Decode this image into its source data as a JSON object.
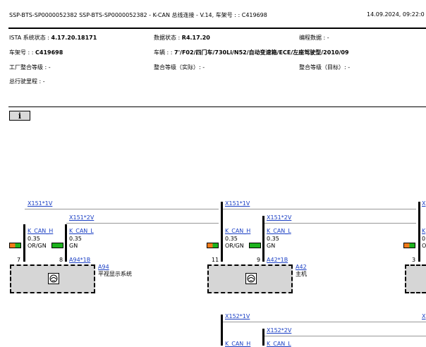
{
  "header": {
    "title": "SSP-BTS-SP0000052382  SSP-BTS-SP0000052382  - K-CAN 总线连接 - V.14, 车架号 : : C419698",
    "datetime": "14.09.2024,  09:22:0"
  },
  "info": {
    "ista_label": "ISTA 系统状态 : ",
    "ista_value": "4.17.20.18171",
    "data_label": "数据状态 : ",
    "data_value": "R4.17.20",
    "prog_label": "编程数据 : -",
    "vin_label": "车架号 : : ",
    "vin_value": "C419698",
    "vehicle_label": "车辆 : : ",
    "vehicle_value": "7'/F02/四门车/730Li/N52/自动变速箱/ECE/左座驾驶型/2010/09",
    "factory_level": "工厂整合等级 : -",
    "actual_level": "整合等级（实际）: -",
    "target_level": "整合等级（目标）: -",
    "mileage": "总行驶里程 : -"
  },
  "info_button": {
    "label": "i"
  },
  "diagram": {
    "modules": [
      {
        "conn1": "X151*1V",
        "conn2": "X151*2V",
        "pin_a": "7",
        "pin_b": "8",
        "w1_name": "K_CAN_H",
        "w1_size": "0.35",
        "w1_color": "OR/GN",
        "w2_name": "K_CAN_L",
        "w2_size": "0.35",
        "w2_color": "GN",
        "plug": "A94*1B",
        "id": "A94",
        "name": "平视显示系统"
      },
      {
        "conn1": "X151*1V",
        "conn2": "X151*2V",
        "pin_a": "11",
        "pin_b": "9",
        "w1_name": "K_CAN_H",
        "w1_size": "0.35",
        "w1_color": "OR/GN",
        "w2_name": "K_CAN_L",
        "w2_size": "0.35",
        "w2_color": "GN",
        "plug": "A42*1B",
        "id": "A42",
        "name": "主机"
      },
      {
        "conn1": "X",
        "pin_a": "3",
        "w1_name": "K",
        "w1_size": "0",
        "w1_color": "O"
      }
    ],
    "lower": {
      "conn1": "X152*1V",
      "conn2": "X152*2V",
      "w1_name": "K_CAN_H",
      "w2_name": "K_CAN_L",
      "edge_conn": "X"
    }
  },
  "colors": {
    "orange": "#f07a1a",
    "green": "#1db21d",
    "link": "#1a3fc4",
    "ecu_fill": "#d6d6d6"
  }
}
